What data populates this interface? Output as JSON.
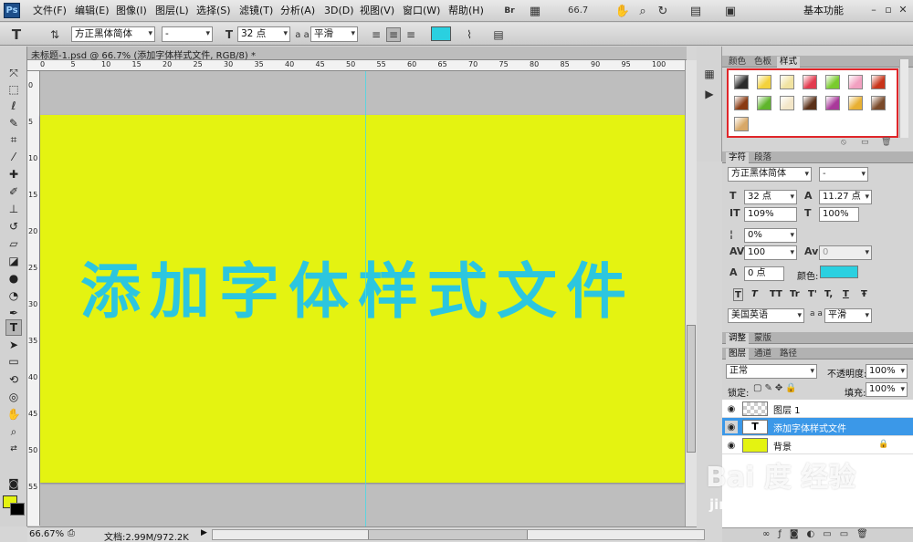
{
  "app": {
    "logo_text": "Ps"
  },
  "menu": {
    "items": [
      "文件(F)",
      "编辑(E)",
      "图像(I)",
      "图层(L)",
      "选择(S)",
      "滤镜(T)",
      "分析(A)",
      "3D(D)",
      "视图(V)",
      "窗口(W)",
      "帮助(H)"
    ],
    "zoom": "66.7",
    "workspace": "基本功能"
  },
  "options": {
    "font_family": "方正黑体简体",
    "font_style": "-",
    "font_size": "32 点",
    "antialias_glyph": "a a",
    "antialias": "平滑",
    "text_color": "#2ad0e0"
  },
  "document": {
    "tab_title": "未标题-1.psd @ 66.7% (添加字体样式文件, RGB/8) *",
    "ruler_top": [
      "0",
      "5",
      "10",
      "15",
      "20",
      "25",
      "30",
      "35",
      "40",
      "45",
      "50",
      "55",
      "60",
      "65",
      "70",
      "75",
      "80",
      "85",
      "90",
      "95",
      "100"
    ],
    "ruler_left": [
      "0",
      "5",
      "10",
      "15",
      "20",
      "25",
      "30",
      "35",
      "40",
      "45",
      "50",
      "55"
    ],
    "canvas_color": "#e4f311",
    "canvas_text": "添加字体样式文件",
    "canvas_text_color": "#2cc6df"
  },
  "status": {
    "zoom": "66.67%",
    "doc_info": "文档:2.99M/972.2K"
  },
  "panels": {
    "styles_tabs": [
      "颜色",
      "色板",
      "样式"
    ],
    "style_swatches": [
      "#2a2a2a",
      "#f4d23c",
      "#f1e3a1",
      "#e23b4f",
      "#7acb2e",
      "#f2a0c0",
      "#c8341a",
      "#8a3a12",
      "#5fb52c",
      "#f3e6c8",
      "#5a3018",
      "#a9399a",
      "#e8b032",
      "#7a4a2a",
      "#d8a868"
    ],
    "character_tabs": [
      "字符",
      "段落"
    ],
    "char_font": "方正黑体简体",
    "char_style": "-",
    "char_size": "32 点",
    "char_leading": "11.27 点",
    "char_vscale": "109%",
    "char_hscale": "100%",
    "char_baseline": "0%",
    "char_tracking": "100",
    "char_kerning": "0",
    "char_shift": "0 点",
    "color_label": "颜色:",
    "char_color": "#2ad0e0",
    "text_buttons": [
      "T",
      "T",
      "TT",
      "Tr",
      "T'",
      "T,",
      "T",
      "Ŧ"
    ],
    "language": "美国英语",
    "aa_glyph": "a a",
    "char_antialias": "平滑",
    "adjust_tabs": [
      "调整",
      "蒙版"
    ],
    "layers_tabs": [
      "图层",
      "通道",
      "路径"
    ],
    "blend_mode": "正常",
    "opacity_label": "不透明度:",
    "opacity": "100%",
    "lock_label": "锁定:",
    "fill_label": "填充:",
    "fill": "100%",
    "layers": [
      {
        "name": "图层 1",
        "thumb": "transparent",
        "selected": false
      },
      {
        "name": "添加字体样式文件",
        "thumb": "text",
        "selected": true
      },
      {
        "name": "背景",
        "thumb": "#e4f311",
        "selected": false
      }
    ]
  },
  "watermark": {
    "logo": "Bai 度 经验",
    "url": "jingyan.baidu.com"
  }
}
